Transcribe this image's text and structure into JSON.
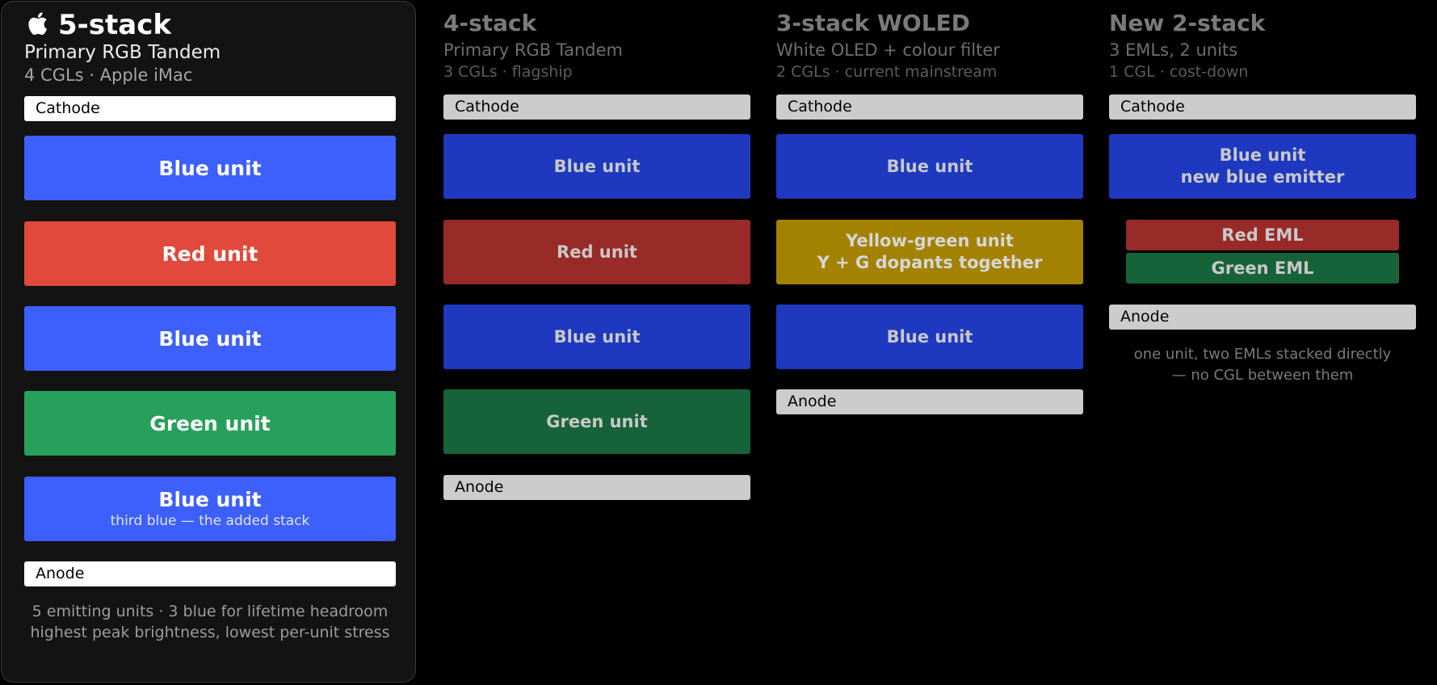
{
  "colors": {
    "cathode_highlight": "#ffffff",
    "cathode_dim": "#cccccc",
    "blue_bright": "#3d5ffc",
    "red_bright": "#e0493b",
    "green_bright": "#26a05b",
    "blue_dim": "#1e39c0",
    "red_dim": "#982a27",
    "green_dim": "#176339",
    "yellow_dim": "#a28200",
    "text_dim": "#7a7a7a",
    "label_dim": "#c8c8c8"
  },
  "columns": [
    {
      "title": "5-stack",
      "subtitle": "Primary RGB Tandem",
      "meta": "4 CGLs · Apple iMac",
      "icon": "apple-logo-icon",
      "layers": [
        {
          "kind": "electrode",
          "label": "Cathode"
        },
        {
          "kind": "unit",
          "label": "Blue unit",
          "color": "blue"
        },
        {
          "kind": "unit",
          "label": "Red unit",
          "color": "red"
        },
        {
          "kind": "unit",
          "label": "Blue unit",
          "color": "blue"
        },
        {
          "kind": "unit",
          "label": "Green unit",
          "color": "green"
        },
        {
          "kind": "unit",
          "label": "Blue unit",
          "sub": "third blue — the added stack",
          "color": "blue"
        },
        {
          "kind": "electrode",
          "label": "Anode"
        }
      ],
      "note": [
        "5 emitting units · 3 blue for lifetime headroom",
        "highest peak brightness, lowest per-unit stress"
      ]
    },
    {
      "title": "4-stack",
      "subtitle": "Primary RGB Tandem",
      "meta": "3 CGLs · flagship",
      "layers": [
        {
          "kind": "electrode",
          "label": "Cathode"
        },
        {
          "kind": "unit",
          "label": "Blue unit",
          "color": "blue"
        },
        {
          "kind": "unit",
          "label": "Red unit",
          "color": "red"
        },
        {
          "kind": "unit",
          "label": "Blue unit",
          "color": "blue"
        },
        {
          "kind": "unit",
          "label": "Green unit",
          "color": "green"
        },
        {
          "kind": "electrode",
          "label": "Anode"
        }
      ]
    },
    {
      "title": "3-stack WOLED",
      "subtitle": "White OLED + colour filter",
      "meta": "2 CGLs · current mainstream",
      "layers": [
        {
          "kind": "electrode",
          "label": "Cathode"
        },
        {
          "kind": "unit",
          "label": "Blue unit",
          "color": "blue"
        },
        {
          "kind": "unit",
          "label": "Yellow-green unit",
          "label2": "Y + G dopants together",
          "color": "yellow"
        },
        {
          "kind": "unit",
          "label": "Blue unit",
          "color": "blue"
        },
        {
          "kind": "electrode",
          "label": "Anode"
        }
      ]
    },
    {
      "title": "New 2-stack",
      "subtitle": "3 EMLs, 2 units",
      "meta": "1 CGL · cost-down",
      "layers": [
        {
          "kind": "electrode",
          "label": "Cathode"
        },
        {
          "kind": "unit",
          "label": "Blue unit",
          "label2": "new blue emitter",
          "color": "blue"
        },
        {
          "kind": "eml-pair",
          "items": [
            {
              "label": "Red EML",
              "color": "red"
            },
            {
              "label": "Green EML",
              "color": "green"
            }
          ]
        },
        {
          "kind": "electrode",
          "label": "Anode"
        }
      ],
      "note": [
        "one unit, two EMLs stacked directly",
        "— no CGL between them"
      ]
    }
  ]
}
